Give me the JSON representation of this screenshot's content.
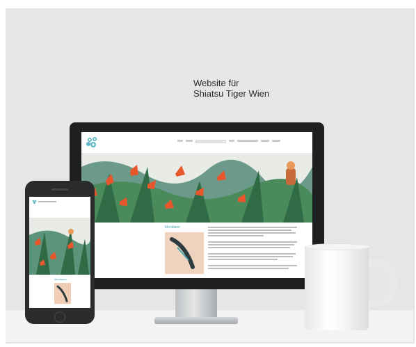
{
  "headline": {
    "line1": "Website für",
    "line2": "Shiatsu Tiger Wien"
  },
  "site": {
    "section_heading": "Meridiane",
    "mobile_section_heading": "Meridiane"
  },
  "colors": {
    "backdrop": "#e6e6e4",
    "device_dark": "#1e1f21",
    "accent_teal": "#49a6b3",
    "flower_orange": "#e8572c",
    "leaf_green": "#3f8a52"
  },
  "icons": [
    "tiger-paw-logo-icon",
    "home-button-icon"
  ]
}
